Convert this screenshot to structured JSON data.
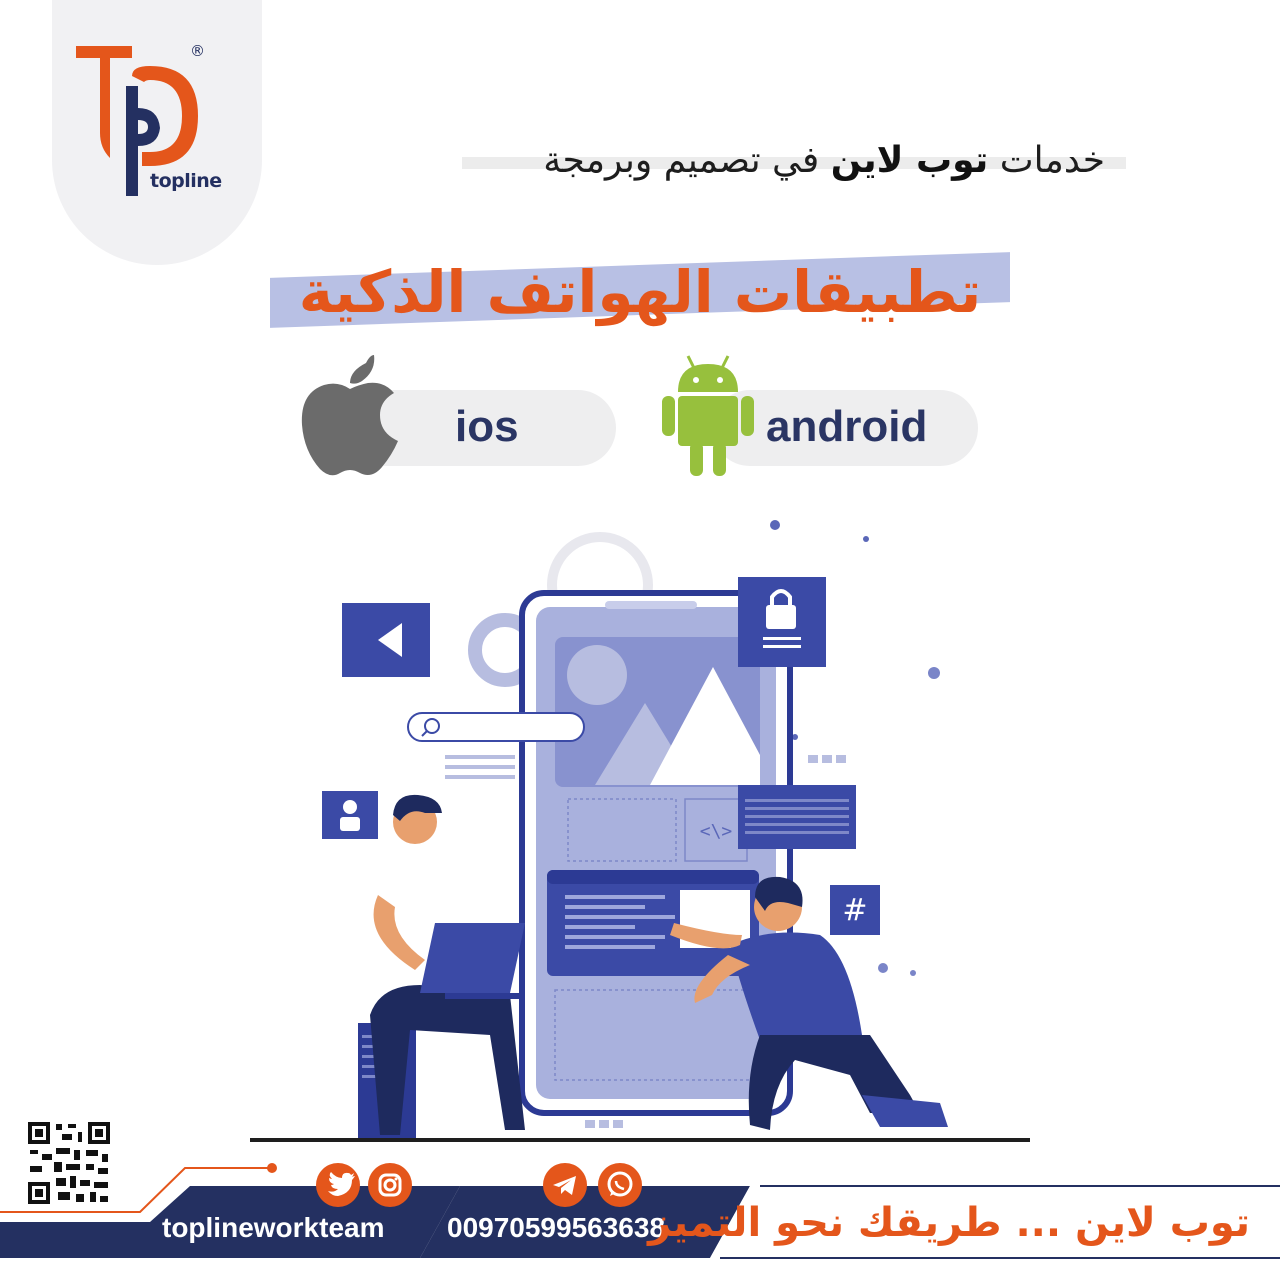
{
  "brand": {
    "logo_text": "topline",
    "registered_mark": "®"
  },
  "header": {
    "subheading_prefix": "خدمات ",
    "subheading_brand": "توب لاين",
    "subheading_suffix": " في تصميم وبرمجة",
    "title": "تطبيقات الهواتف الذكية"
  },
  "platforms": [
    {
      "label": "ios",
      "icon": "apple-icon"
    },
    {
      "label": "android",
      "icon": "android-icon"
    }
  ],
  "footer": {
    "social_handle": "toplineworkteam",
    "social_icons": [
      "twitter-icon",
      "instagram-icon"
    ],
    "phone": "00970599563638",
    "phone_icons": [
      "telegram-icon",
      "whatsapp-icon"
    ],
    "slogan": "توب لاين ... طريقك نحو التميز"
  },
  "colors": {
    "brand_orange": "#e4561b",
    "brand_navy": "#243061",
    "android_green": "#97c03d",
    "apple_gray": "#6b6b6b",
    "illustration_blue": "#3b4aa6"
  }
}
